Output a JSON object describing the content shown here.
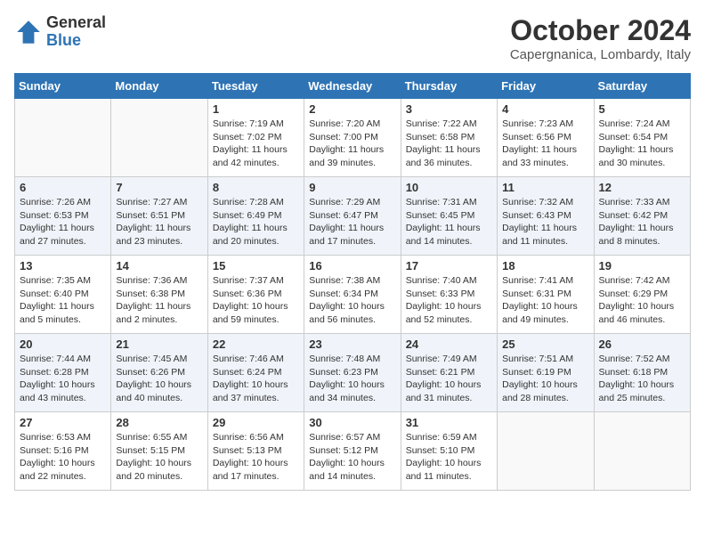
{
  "header": {
    "logo_general": "General",
    "logo_blue": "Blue",
    "month_title": "October 2024",
    "location": "Capergnanica, Lombardy, Italy"
  },
  "days_of_week": [
    "Sunday",
    "Monday",
    "Tuesday",
    "Wednesday",
    "Thursday",
    "Friday",
    "Saturday"
  ],
  "weeks": [
    [
      {
        "day": "",
        "empty": true
      },
      {
        "day": "",
        "empty": true
      },
      {
        "day": "1",
        "sunrise": "Sunrise: 7:19 AM",
        "sunset": "Sunset: 7:02 PM",
        "daylight": "Daylight: 11 hours and 42 minutes."
      },
      {
        "day": "2",
        "sunrise": "Sunrise: 7:20 AM",
        "sunset": "Sunset: 7:00 PM",
        "daylight": "Daylight: 11 hours and 39 minutes."
      },
      {
        "day": "3",
        "sunrise": "Sunrise: 7:22 AM",
        "sunset": "Sunset: 6:58 PM",
        "daylight": "Daylight: 11 hours and 36 minutes."
      },
      {
        "day": "4",
        "sunrise": "Sunrise: 7:23 AM",
        "sunset": "Sunset: 6:56 PM",
        "daylight": "Daylight: 11 hours and 33 minutes."
      },
      {
        "day": "5",
        "sunrise": "Sunrise: 7:24 AM",
        "sunset": "Sunset: 6:54 PM",
        "daylight": "Daylight: 11 hours and 30 minutes."
      }
    ],
    [
      {
        "day": "6",
        "sunrise": "Sunrise: 7:26 AM",
        "sunset": "Sunset: 6:53 PM",
        "daylight": "Daylight: 11 hours and 27 minutes."
      },
      {
        "day": "7",
        "sunrise": "Sunrise: 7:27 AM",
        "sunset": "Sunset: 6:51 PM",
        "daylight": "Daylight: 11 hours and 23 minutes."
      },
      {
        "day": "8",
        "sunrise": "Sunrise: 7:28 AM",
        "sunset": "Sunset: 6:49 PM",
        "daylight": "Daylight: 11 hours and 20 minutes."
      },
      {
        "day": "9",
        "sunrise": "Sunrise: 7:29 AM",
        "sunset": "Sunset: 6:47 PM",
        "daylight": "Daylight: 11 hours and 17 minutes."
      },
      {
        "day": "10",
        "sunrise": "Sunrise: 7:31 AM",
        "sunset": "Sunset: 6:45 PM",
        "daylight": "Daylight: 11 hours and 14 minutes."
      },
      {
        "day": "11",
        "sunrise": "Sunrise: 7:32 AM",
        "sunset": "Sunset: 6:43 PM",
        "daylight": "Daylight: 11 hours and 11 minutes."
      },
      {
        "day": "12",
        "sunrise": "Sunrise: 7:33 AM",
        "sunset": "Sunset: 6:42 PM",
        "daylight": "Daylight: 11 hours and 8 minutes."
      }
    ],
    [
      {
        "day": "13",
        "sunrise": "Sunrise: 7:35 AM",
        "sunset": "Sunset: 6:40 PM",
        "daylight": "Daylight: 11 hours and 5 minutes."
      },
      {
        "day": "14",
        "sunrise": "Sunrise: 7:36 AM",
        "sunset": "Sunset: 6:38 PM",
        "daylight": "Daylight: 11 hours and 2 minutes."
      },
      {
        "day": "15",
        "sunrise": "Sunrise: 7:37 AM",
        "sunset": "Sunset: 6:36 PM",
        "daylight": "Daylight: 10 hours and 59 minutes."
      },
      {
        "day": "16",
        "sunrise": "Sunrise: 7:38 AM",
        "sunset": "Sunset: 6:34 PM",
        "daylight": "Daylight: 10 hours and 56 minutes."
      },
      {
        "day": "17",
        "sunrise": "Sunrise: 7:40 AM",
        "sunset": "Sunset: 6:33 PM",
        "daylight": "Daylight: 10 hours and 52 minutes."
      },
      {
        "day": "18",
        "sunrise": "Sunrise: 7:41 AM",
        "sunset": "Sunset: 6:31 PM",
        "daylight": "Daylight: 10 hours and 49 minutes."
      },
      {
        "day": "19",
        "sunrise": "Sunrise: 7:42 AM",
        "sunset": "Sunset: 6:29 PM",
        "daylight": "Daylight: 10 hours and 46 minutes."
      }
    ],
    [
      {
        "day": "20",
        "sunrise": "Sunrise: 7:44 AM",
        "sunset": "Sunset: 6:28 PM",
        "daylight": "Daylight: 10 hours and 43 minutes."
      },
      {
        "day": "21",
        "sunrise": "Sunrise: 7:45 AM",
        "sunset": "Sunset: 6:26 PM",
        "daylight": "Daylight: 10 hours and 40 minutes."
      },
      {
        "day": "22",
        "sunrise": "Sunrise: 7:46 AM",
        "sunset": "Sunset: 6:24 PM",
        "daylight": "Daylight: 10 hours and 37 minutes."
      },
      {
        "day": "23",
        "sunrise": "Sunrise: 7:48 AM",
        "sunset": "Sunset: 6:23 PM",
        "daylight": "Daylight: 10 hours and 34 minutes."
      },
      {
        "day": "24",
        "sunrise": "Sunrise: 7:49 AM",
        "sunset": "Sunset: 6:21 PM",
        "daylight": "Daylight: 10 hours and 31 minutes."
      },
      {
        "day": "25",
        "sunrise": "Sunrise: 7:51 AM",
        "sunset": "Sunset: 6:19 PM",
        "daylight": "Daylight: 10 hours and 28 minutes."
      },
      {
        "day": "26",
        "sunrise": "Sunrise: 7:52 AM",
        "sunset": "Sunset: 6:18 PM",
        "daylight": "Daylight: 10 hours and 25 minutes."
      }
    ],
    [
      {
        "day": "27",
        "sunrise": "Sunrise: 6:53 AM",
        "sunset": "Sunset: 5:16 PM",
        "daylight": "Daylight: 10 hours and 22 minutes."
      },
      {
        "day": "28",
        "sunrise": "Sunrise: 6:55 AM",
        "sunset": "Sunset: 5:15 PM",
        "daylight": "Daylight: 10 hours and 20 minutes."
      },
      {
        "day": "29",
        "sunrise": "Sunrise: 6:56 AM",
        "sunset": "Sunset: 5:13 PM",
        "daylight": "Daylight: 10 hours and 17 minutes."
      },
      {
        "day": "30",
        "sunrise": "Sunrise: 6:57 AM",
        "sunset": "Sunset: 5:12 PM",
        "daylight": "Daylight: 10 hours and 14 minutes."
      },
      {
        "day": "31",
        "sunrise": "Sunrise: 6:59 AM",
        "sunset": "Sunset: 5:10 PM",
        "daylight": "Daylight: 10 hours and 11 minutes."
      },
      {
        "day": "",
        "empty": true
      },
      {
        "day": "",
        "empty": true
      }
    ]
  ]
}
